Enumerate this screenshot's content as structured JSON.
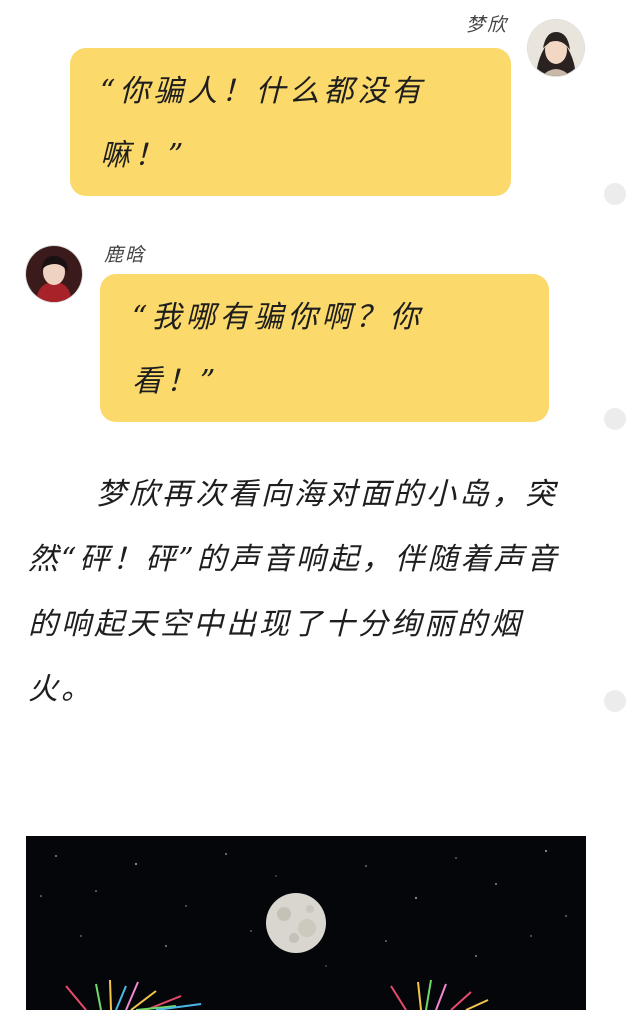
{
  "messages": [
    {
      "speaker": "梦欣",
      "text": "“你骗人！什么都没有嘛！”",
      "side": "right"
    },
    {
      "speaker": "鹿晗",
      "text": "“我哪有骗你啊？你看！”",
      "side": "left"
    }
  ],
  "narrative": "梦欣再次看向海对面的小岛，突然“砰！砰”的声音响起，伴随着声音的响起天空中出现了十分绚丽的烟火。",
  "colors": {
    "bubble": "#fbd96a",
    "sky": "#05060a",
    "moon": "#d9d6cf",
    "scroll_dot": "#ececec"
  },
  "icons": {
    "avatar_right": "female-portrait-avatar",
    "avatar_left": "male-portrait-avatar",
    "photo": "full-moon-fireworks-night-photo"
  }
}
